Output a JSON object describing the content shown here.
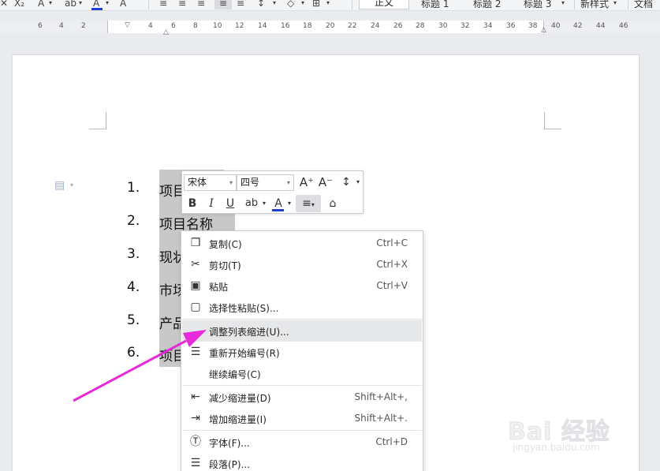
{
  "toolbar": {
    "subscript": "X₂",
    "font_effect": "A",
    "highlight": "ab",
    "font_color": "A",
    "char_shade": "A",
    "styles": [
      "正文",
      "标题 1",
      "标题 2",
      "标题 3"
    ],
    "new_style": "新样式",
    "doc_assistant": "文档助"
  },
  "ruler": {
    "left_ticks": [
      "6",
      "4",
      "2"
    ],
    "right_ticks": [
      "4",
      "6",
      "8",
      "10",
      "12",
      "14",
      "16",
      "18",
      "20",
      "22",
      "24",
      "26",
      "28",
      "30",
      "32",
      "34",
      "36",
      "38",
      "40",
      "42",
      "44",
      "46"
    ]
  },
  "document": {
    "list_numbers": [
      "1.",
      "2.",
      "3.",
      "4.",
      "5.",
      "6."
    ],
    "list_items": [
      "项目",
      "项目名称",
      "现状",
      "市场",
      "产品",
      "项目"
    ]
  },
  "mini_toolbar": {
    "font_name": "宋体",
    "font_size": "四号",
    "grow_font": "A⁺",
    "shrink_font": "A⁻",
    "bold": "B",
    "italic": "I",
    "underline": "U",
    "highlight": "ab",
    "font_color": "A"
  },
  "context_menu": {
    "items": [
      {
        "label": "复制(C)",
        "shortcut": "Ctrl+C",
        "icon": "copy-icon"
      },
      {
        "label": "剪切(T)",
        "shortcut": "Ctrl+X",
        "icon": "scissors-icon"
      },
      {
        "label": "粘贴",
        "shortcut": "Ctrl+V",
        "icon": "paste-icon"
      },
      {
        "label": "选择性粘贴(S)...",
        "shortcut": "",
        "icon": "paste-special-icon"
      },
      {
        "label": "调整列表缩进(U)...",
        "shortcut": "",
        "icon": ""
      },
      {
        "label": "重新开始编号(R)",
        "shortcut": "",
        "icon": "restart-numbering-icon"
      },
      {
        "label": "继续编号(C)",
        "shortcut": "",
        "icon": ""
      },
      {
        "label": "减少缩进量(D)",
        "shortcut": "Shift+Alt+,",
        "icon": "decrease-indent-icon"
      },
      {
        "label": "增加缩进量(I)",
        "shortcut": "Shift+Alt+.",
        "icon": "increase-indent-icon"
      },
      {
        "label": "字体(F)...",
        "shortcut": "Ctrl+D",
        "icon": "font-icon"
      },
      {
        "label": "段落(P)...",
        "shortcut": "",
        "icon": "paragraph-icon"
      }
    ]
  },
  "watermark": {
    "brand": "Bai 经验",
    "url": "jingyan.baidu.com"
  },
  "colors": {
    "font_color_bar": "#1f3fd6",
    "annotation_arrow": "#e62ad9",
    "selection": "#c8c8c8"
  }
}
